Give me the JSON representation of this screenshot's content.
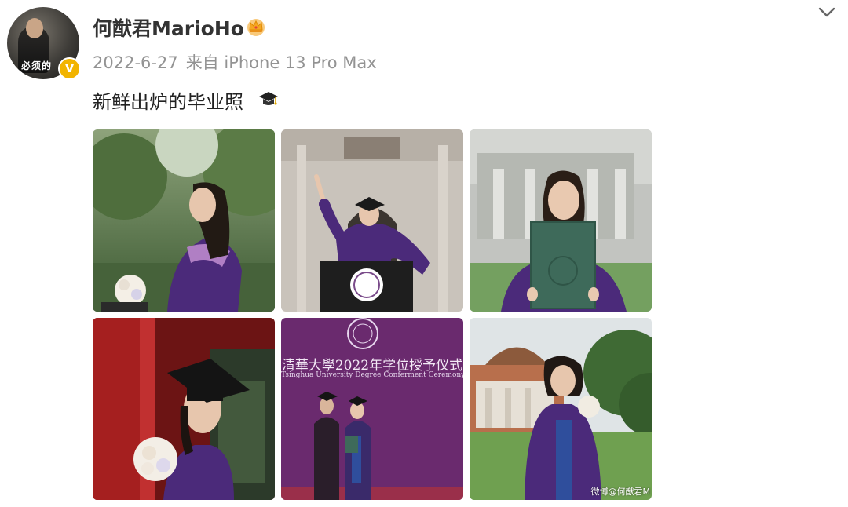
{
  "post": {
    "username": "何猷君MarioHo",
    "date": "2022-6-27",
    "source": "来自 iPhone 13 Pro Max",
    "text": "新鲜出炉的毕业照",
    "avatar_caption": "必须的",
    "verified_mark": "V",
    "icons": {
      "member": "crown-icon",
      "verified": "verified-badge-icon",
      "more": "chevron-down-icon",
      "emoji": "graduation-cap-icon"
    },
    "colors": {
      "text": "#333333",
      "meta": "#939393",
      "verified": "#f2b400",
      "gown_purple": "#4b2a7a"
    }
  },
  "photos": [
    {
      "subject": "graduate-profile-with-bouquet"
    },
    {
      "subject": "graduate-raising-arm-behind-podium"
    },
    {
      "subject": "graduate-holding-diploma"
    },
    {
      "subject": "graduate-in-red-doorway-with-bouquet"
    },
    {
      "subject": "degree-conferment-ceremony-stage",
      "banner_title": "清華大學2022年学位授予仪式",
      "banner_subtitle": "Tsinghua University Degree Conferment Ceremony 2022"
    },
    {
      "subject": "graduate-on-lawn-before-auditorium",
      "watermark": "微博@何猷君M"
    }
  ]
}
